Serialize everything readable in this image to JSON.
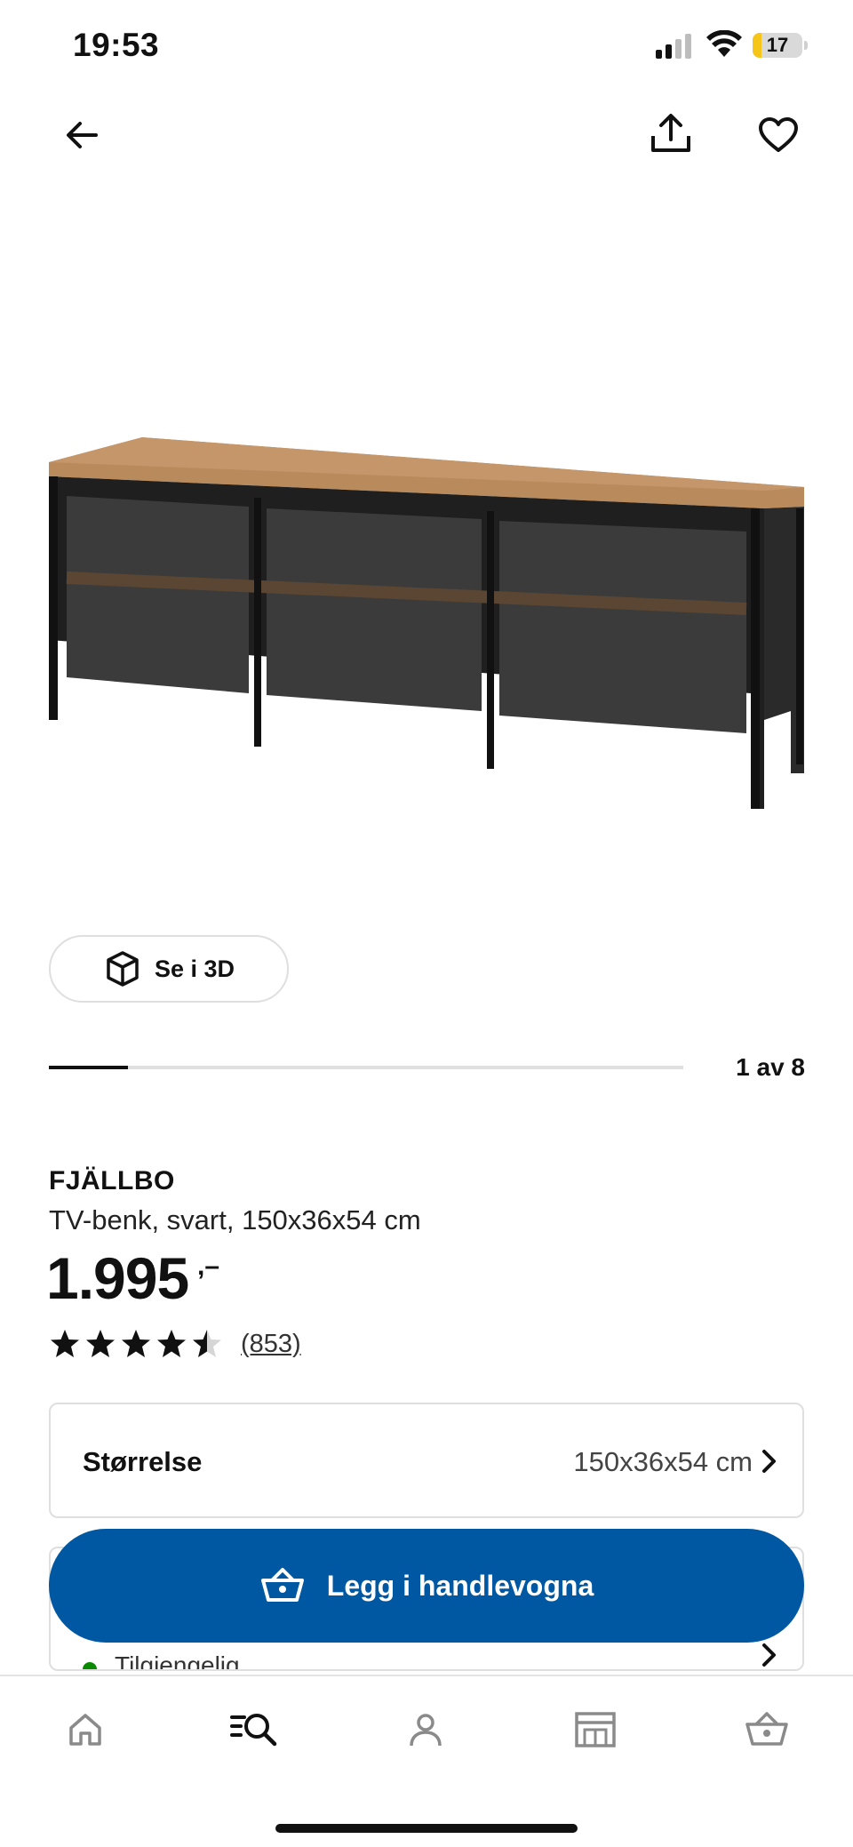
{
  "status_bar": {
    "time": "19:53",
    "battery_level": "17",
    "battery_fraction": 0.17,
    "battery_color": "#f5c518",
    "icons": [
      "signal-icon",
      "wifi-icon",
      "battery-icon"
    ]
  },
  "top_actions": {
    "back_icon": "arrow-left-icon",
    "share_icon": "share-icon",
    "favorite_icon": "heart-icon"
  },
  "product_image": {
    "subject": "tv-bench"
  },
  "view_3d": {
    "label": "Se i 3D",
    "icon": "cube-icon"
  },
  "carousel": {
    "count_label": "1 av 8",
    "current": 1,
    "total": 8
  },
  "product": {
    "name": "FJÄLLBO",
    "description": "TV-benk, svart, 150x36x54 cm",
    "price": "1.995",
    "price_suffix": ",–",
    "rating_value": 4.5,
    "rating_max": 5,
    "review_count": "(853)"
  },
  "size_selector": {
    "label": "Størrelse",
    "value": "150x36x54 cm",
    "icon": "chevron-right-icon"
  },
  "availability": {
    "text": "Tilgjengelig",
    "status_color": "#0a8a00",
    "icon": "chevron-right-icon"
  },
  "add_to_cart": {
    "label": "Legg i handlevogna",
    "icon": "basket-icon",
    "color": "#0058a3"
  },
  "bottom_nav": {
    "items": [
      {
        "icon": "home-icon"
      },
      {
        "icon": "search-icon"
      },
      {
        "icon": "profile-icon"
      },
      {
        "icon": "store-icon"
      },
      {
        "icon": "basket-icon"
      }
    ]
  }
}
